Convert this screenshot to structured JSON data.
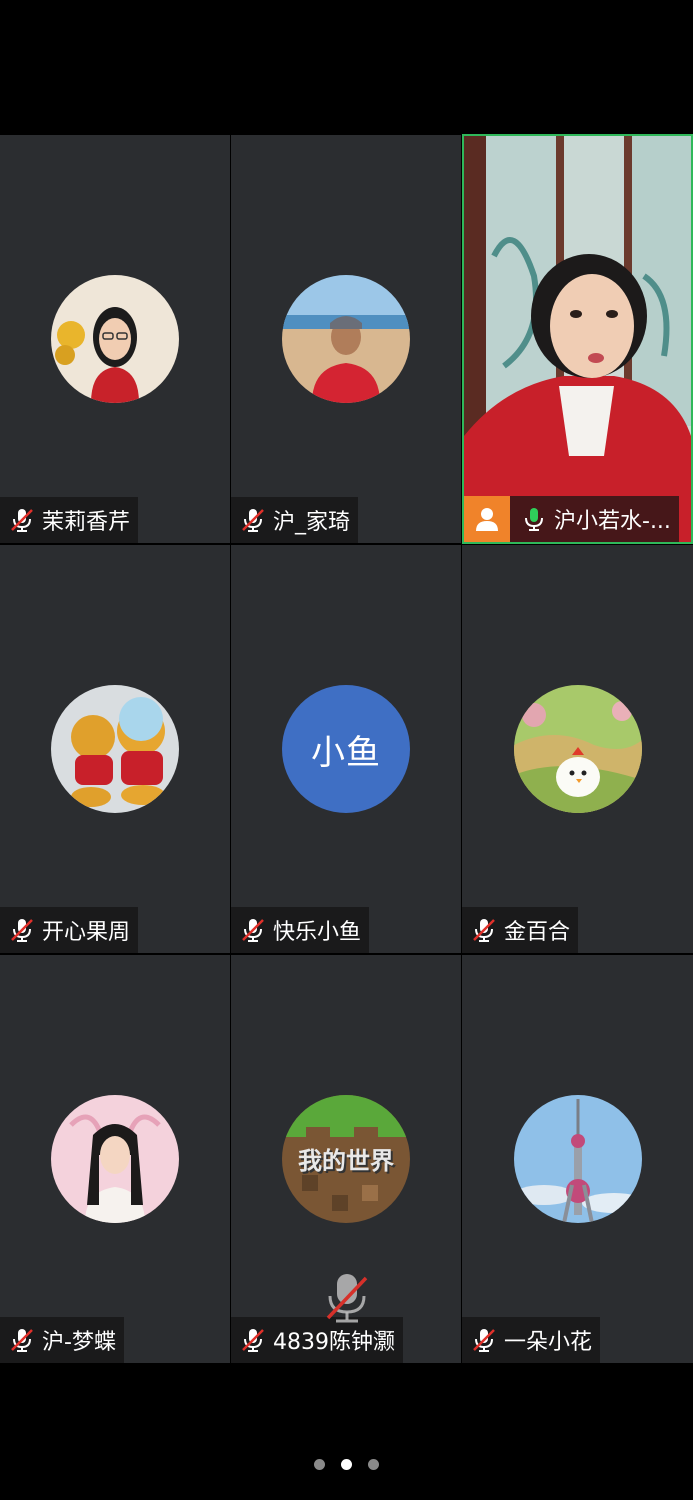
{
  "participants": [
    {
      "name": "茉莉香芹",
      "muted": true,
      "avatar": "woman-glasses-photo"
    },
    {
      "name": "沪_家琦",
      "muted": true,
      "avatar": "man-beach-photo"
    },
    {
      "name": "沪小若水-...",
      "muted": false,
      "avatar": "live-video",
      "host": true
    },
    {
      "name": "开心果周",
      "muted": true,
      "avatar": "winnie-pooh-plush-photo"
    },
    {
      "name": "快乐小鱼",
      "muted": true,
      "avatar_text": "小鱼"
    },
    {
      "name": "金百合",
      "muted": true,
      "avatar": "cartoon-chick-photo"
    },
    {
      "name": "沪-梦蝶",
      "muted": true,
      "avatar": "girl-pink-photo"
    },
    {
      "name": "4839陈钟灏",
      "muted": true,
      "avatar": "minecraft-logo",
      "avatar_label": "我的世界"
    },
    {
      "name": "一朵小花",
      "muted": true,
      "avatar": "oriental-pearl-tower-photo"
    }
  ],
  "colors": {
    "tile_bg": "#2b2d30",
    "active_border": "#2fb85a",
    "host_badge": "#f0832a",
    "mic_active": "#2fcf5a",
    "mic_muted_slash": "#e0302a",
    "text_avatar_bg": "#3f6fc4"
  },
  "pager": {
    "count": 3,
    "current": 2
  }
}
